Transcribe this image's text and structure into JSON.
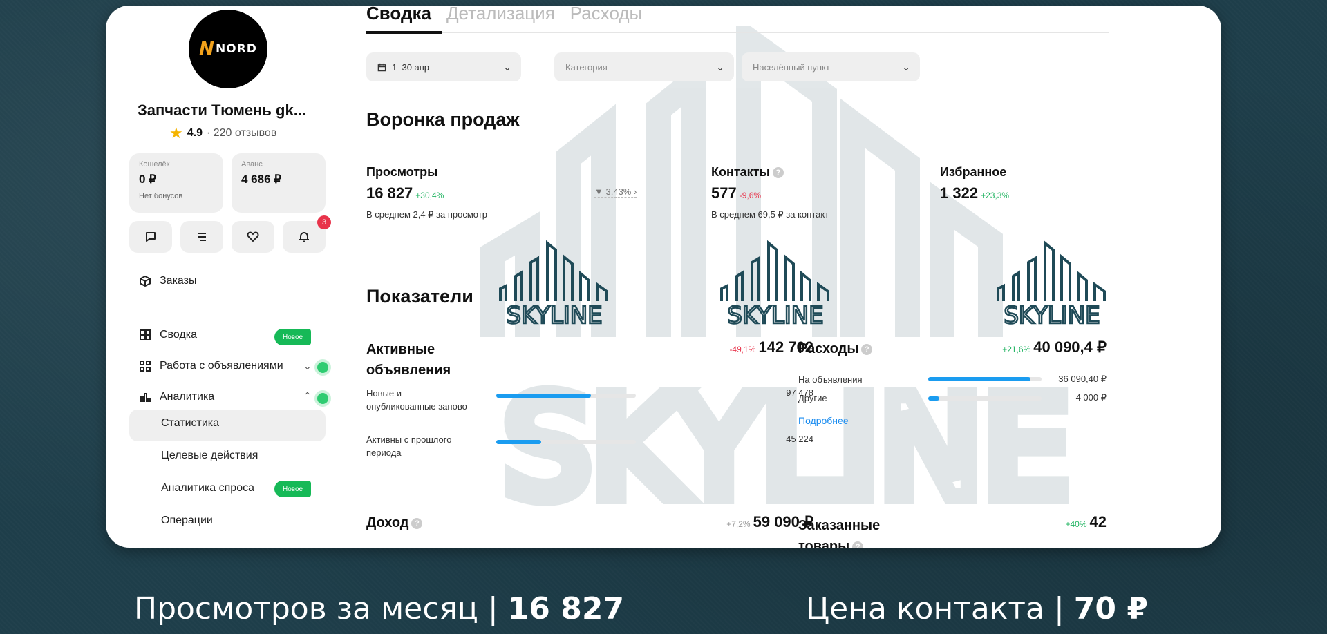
{
  "sidebar": {
    "logo_text": "NORD",
    "shop_name": "Запчасти Тюмень gk...",
    "rating": "4.9",
    "reviews": "· 220 отзывов",
    "wallet": {
      "caption": "Кошелёк",
      "value": "0 ₽",
      "note": "Нет бонусов"
    },
    "advance": {
      "caption": "Аванс",
      "value": "4 686 ₽"
    },
    "notifications_count": "3",
    "orders": "Заказы",
    "summary": "Сводка",
    "new_badge": "Новое",
    "ads_work": "Работа с объявлениями",
    "analytics": "Аналитика",
    "statistics": "Статистика",
    "target_actions": "Целевые действия",
    "demand_analytics": "Аналитика спроса",
    "operations": "Операции"
  },
  "tabs": [
    "Сводка",
    "Детализация",
    "Расходы"
  ],
  "filters": {
    "period": "1–30 апр",
    "category": "Категория",
    "locality": "Населённый пункт"
  },
  "funnel": {
    "title": "Воронка продаж",
    "views": {
      "label": "Просмотры",
      "value": "16 827",
      "delta": "+30,4%",
      "note": "В среднем 2,4 ₽ за просмотр"
    },
    "conversion": "3,43%",
    "contacts": {
      "label": "Контакты",
      "value": "577",
      "delta": "-9,6%",
      "note": "В среднем 69,5 ₽ за контакт"
    },
    "favorites": {
      "label": "Избранное",
      "value": "1 322",
      "delta": "+23,3%"
    }
  },
  "indicators": {
    "title": "Показатели",
    "active_ads": {
      "label": "Активные объявления",
      "delta": "-49,1%",
      "value": "142 702",
      "rows": [
        {
          "label": "Новые и опубликованные заново",
          "value": "97 478",
          "share": 0.68
        },
        {
          "label": "Активны с прошлого периода",
          "value": "45 224",
          "share": 0.32
        }
      ]
    },
    "expenses": {
      "label": "Расходы",
      "delta": "+21,6%",
      "value": "40 090,4 ₽",
      "rows": [
        {
          "label": "На объявления",
          "value": "36 090,40 ₽",
          "share": 0.9
        },
        {
          "label": "Другие",
          "value": "4 000 ₽",
          "share": 0.1
        }
      ],
      "more_link": "Подробнее"
    },
    "income": {
      "label": "Доход",
      "delta": "+7,2%",
      "value": "59 090 ₽"
    },
    "ordered": {
      "label": "Заказанные товары",
      "delta": "+40%",
      "value": "42"
    }
  },
  "watermark": "SKYLINE",
  "captions": {
    "left_text": "Просмотров за месяц  |",
    "left_value": "16 827",
    "right_text": "Цена контакта  |",
    "right_value": "70 ₽"
  },
  "colors": {
    "accent_green": "#16b957",
    "bar_blue": "#1a9cf0",
    "negative": "#e8334a",
    "watermark": "#1f4a57"
  }
}
